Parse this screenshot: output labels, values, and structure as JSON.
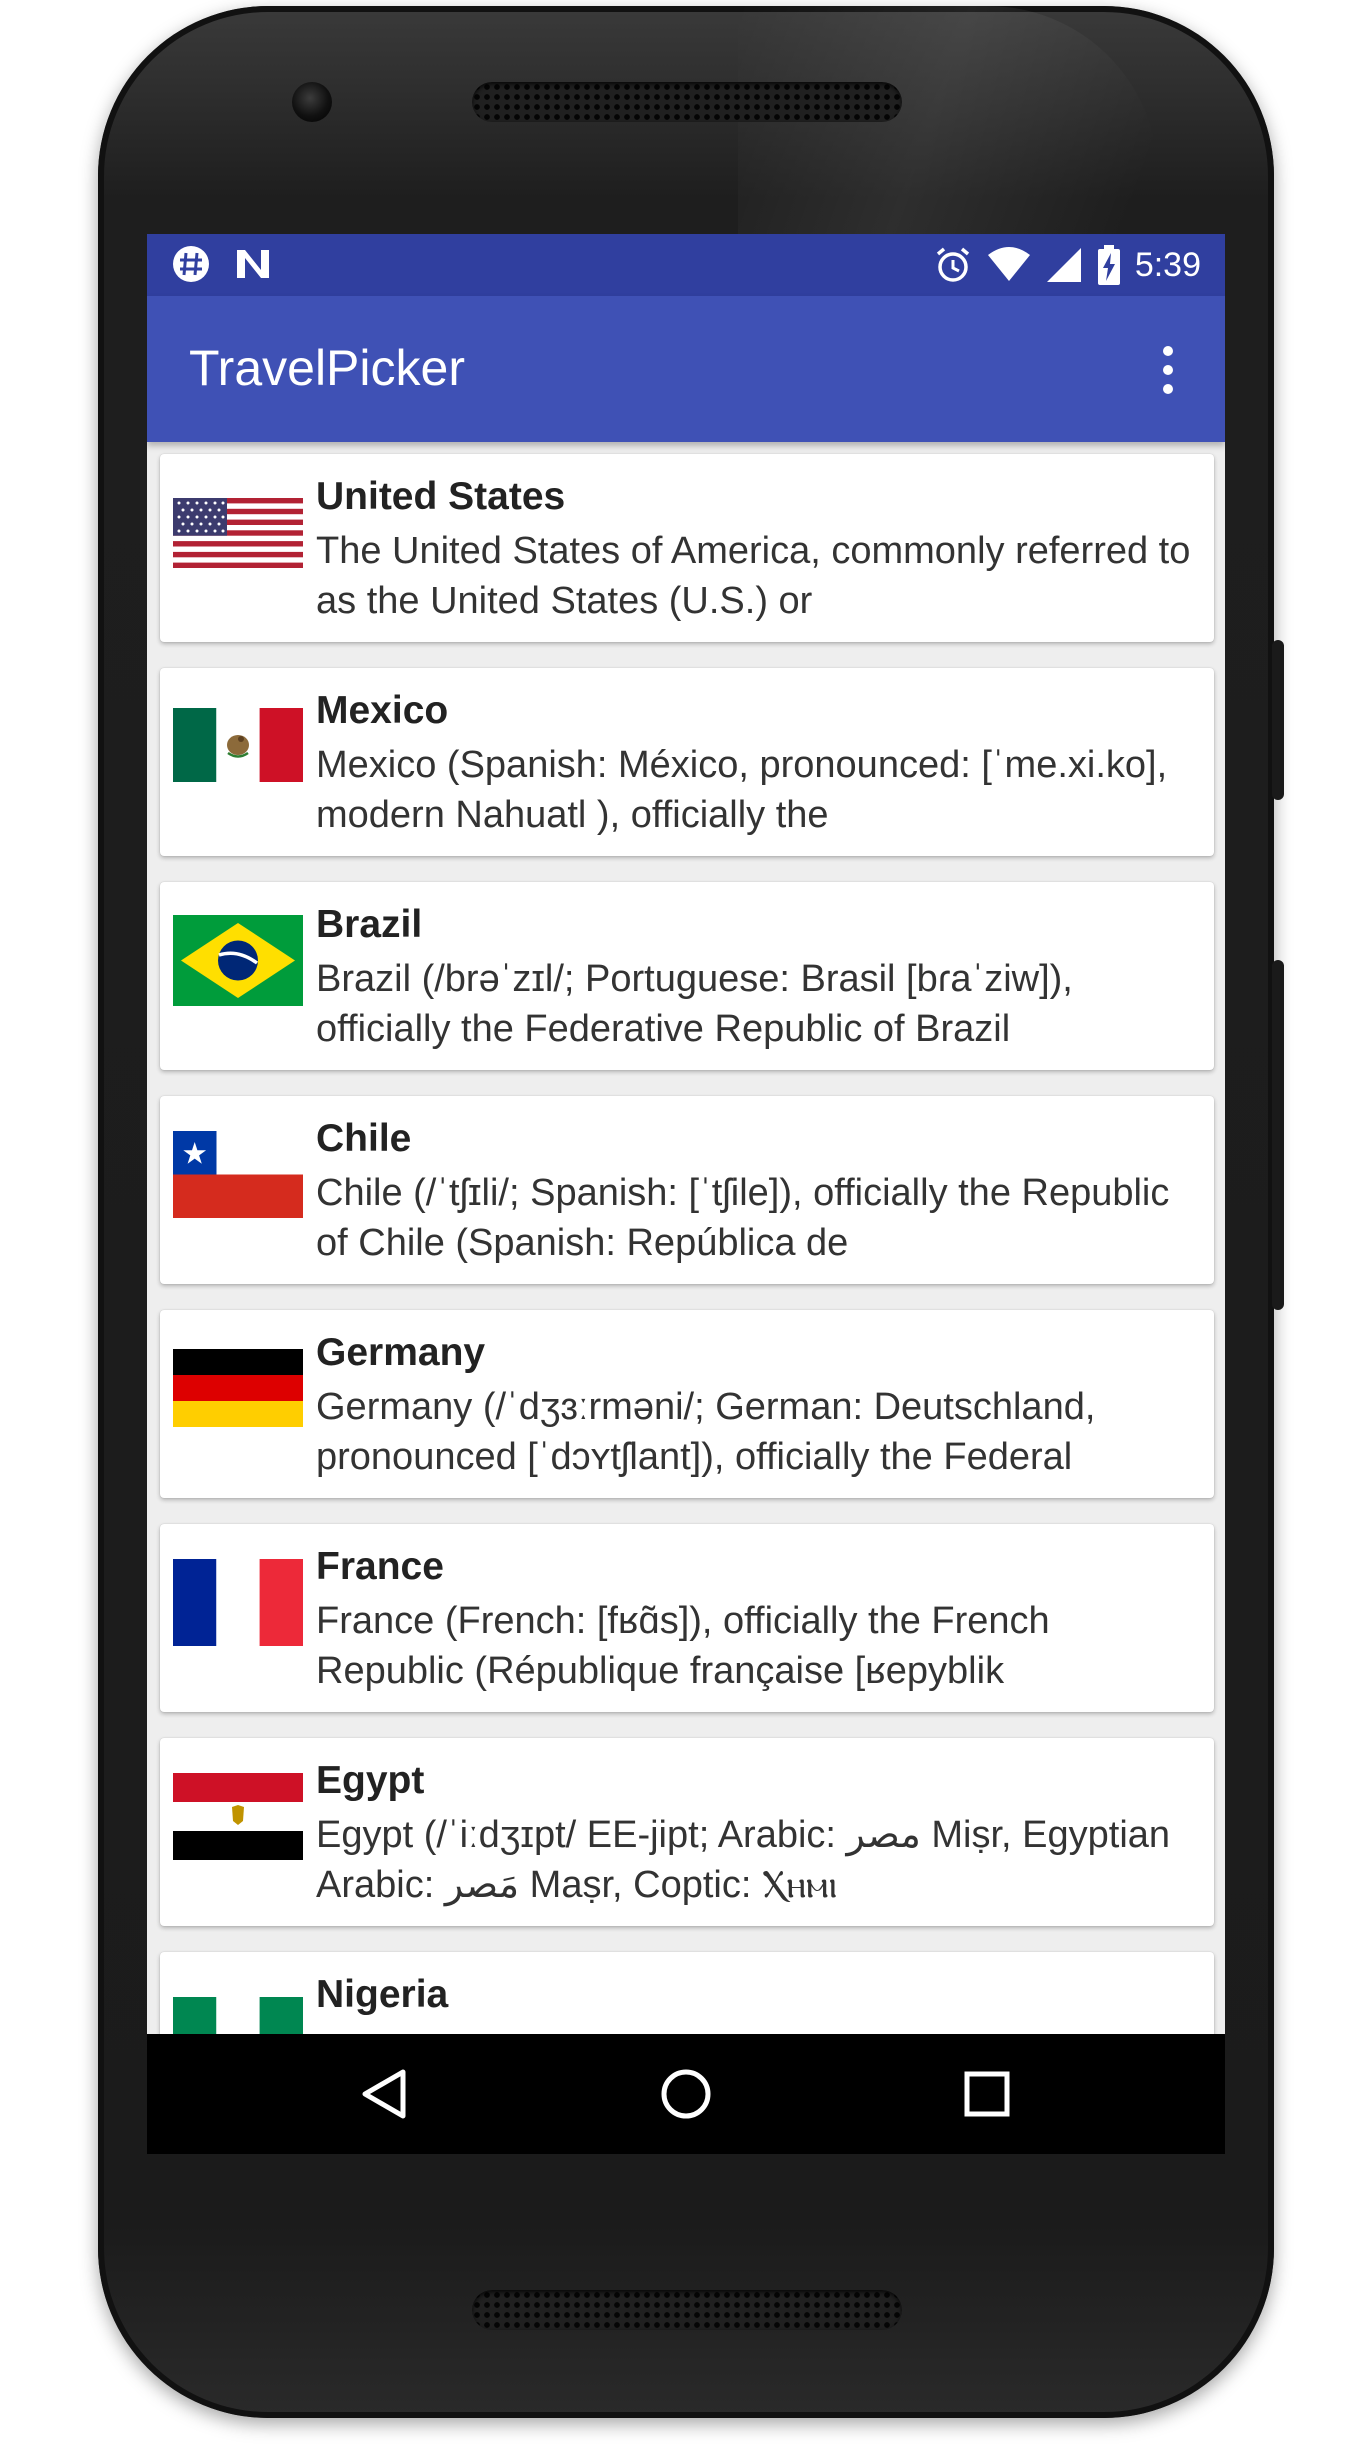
{
  "status_bar": {
    "time": "5:39",
    "left_icons": [
      "settings-notification-icon",
      "n-notification-icon"
    ],
    "right_icons": [
      "alarm-icon",
      "wifi-icon",
      "cell-signal-icon",
      "battery-charging-icon"
    ]
  },
  "app_bar": {
    "title": "TravelPicker",
    "overflow_icon": "more-vert-icon"
  },
  "countries": [
    {
      "name": "United States",
      "description": "The United States of America, commonly referred to as the United States (U.S.) or",
      "flag": "us-flag-icon"
    },
    {
      "name": "Mexico",
      "description": "Mexico (Spanish: México, pronounced: [ˈme.xi.ko], modern Nahuatl ), officially the",
      "flag": "mexico-flag-icon"
    },
    {
      "name": "Brazil",
      "description": "Brazil (/brəˈzɪl/; Portuguese: Brasil [bɾaˈziw]), officially the Federative Republic of Brazil",
      "flag": "brazil-flag-icon"
    },
    {
      "name": "Chile",
      "description": "Chile (/ˈtʃɪli/; Spanish: [ˈtʃile]), officially the Republic of Chile (Spanish:  República de",
      "flag": "chile-flag-icon"
    },
    {
      "name": "Germany",
      "description": "Germany (/ˈdʒɜːrməni/; German: Deutschland, pronounced [ˈdɔʏtʃlant]), officially the Federal",
      "flag": "germany-flag-icon"
    },
    {
      "name": "France",
      "description": "France (French: [fʁɑ̃s]), officially the French Republic (République française [ʁepyblik",
      "flag": "france-flag-icon"
    },
    {
      "name": "Egypt",
      "description": "Egypt (/ˈiːdʒɪpt/ EE-jipt; Arabic: مصر‎ Miṣr, Egyptian Arabic: مَصر Maṣr, Coptic: Ⲭⲏⲙⲓ",
      "flag": "egypt-flag-icon"
    },
    {
      "name": "Nigeria",
      "description": "",
      "flag": "nigeria-flag-icon"
    }
  ],
  "nav_bar": {
    "icons": [
      "back-icon",
      "home-icon",
      "recents-icon"
    ]
  },
  "colors": {
    "primary": "#3f51b5",
    "primary_dark": "#303f9f",
    "background": "#eeeeee",
    "card": "#ffffff"
  }
}
